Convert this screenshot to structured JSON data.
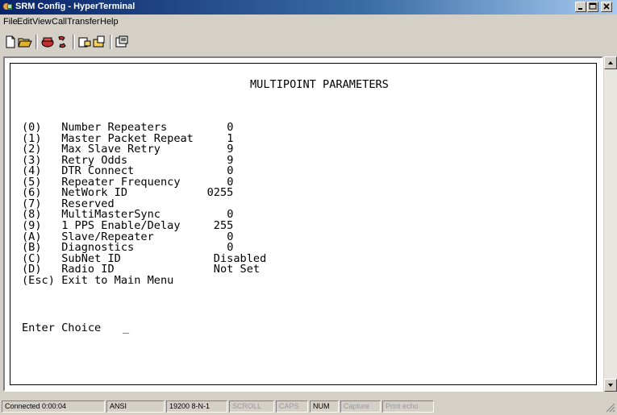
{
  "window": {
    "title": "SRM Config - HyperTerminal"
  },
  "menu": [
    "File",
    "Edit",
    "View",
    "Call",
    "Transfer",
    "Help"
  ],
  "toolbar": {
    "buttons": [
      "new-connection-icon",
      "open-icon",
      "connect-icon",
      "disconnect-icon",
      "send-icon",
      "receive-icon",
      "properties-icon"
    ]
  },
  "terminal": {
    "heading": "MULTIPOINT PARAMETERS",
    "options": [
      {
        "key": "(0)",
        "label": "Number Repeaters",
        "value": "0"
      },
      {
        "key": "(1)",
        "label": "Master Packet Repeat",
        "value": "1"
      },
      {
        "key": "(2)",
        "label": "Max Slave Retry",
        "value": "9"
      },
      {
        "key": "(3)",
        "label": "Retry Odds",
        "value": "9"
      },
      {
        "key": "(4)",
        "label": "DTR Connect",
        "value": "0"
      },
      {
        "key": "(5)",
        "label": "Repeater Frequency",
        "value": "0"
      },
      {
        "key": "(6)",
        "label": "NetWork ID",
        "value": "0255"
      },
      {
        "key": "(7)",
        "label": "Reserved",
        "value": ""
      },
      {
        "key": "(8)",
        "label": "MultiMasterSync",
        "value": "0"
      },
      {
        "key": "(9)",
        "label": "1 PPS Enable/Delay",
        "value": "255"
      },
      {
        "key": "(A)",
        "label": "Slave/Repeater",
        "value": "0"
      },
      {
        "key": "(B)",
        "label": "Diagnostics",
        "value": "0"
      },
      {
        "key": "(C)",
        "label": "SubNet ID",
        "value": "Disabled"
      },
      {
        "key": "(D)",
        "label": "Radio ID",
        "value": "Not Set"
      },
      {
        "key": "(Esc)",
        "label": "Exit to Main Menu",
        "value": ""
      }
    ],
    "prompt": "Enter Choice",
    "cursor": "_"
  },
  "status": {
    "connected": "Connected 0:00:04",
    "emulation": "ANSI",
    "settings": "19200 8-N-1",
    "scroll": "SCROLL",
    "caps": "CAPS",
    "num": "NUM",
    "capture": "Capture",
    "print_echo": "Print echo"
  }
}
